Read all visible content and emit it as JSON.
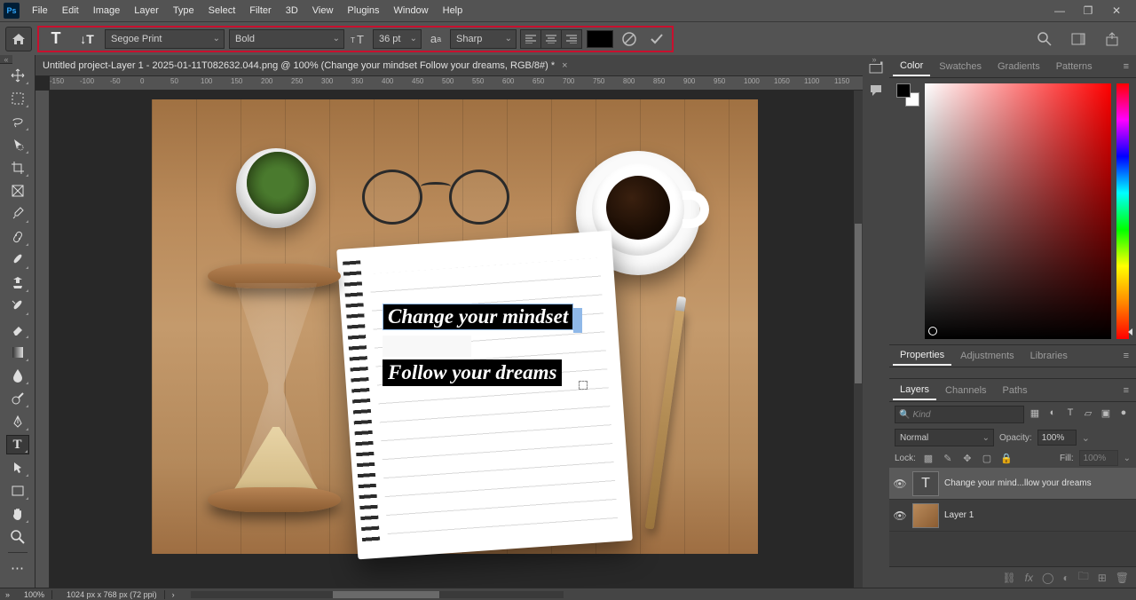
{
  "menu": {
    "items": [
      "File",
      "Edit",
      "Image",
      "Layer",
      "Type",
      "Select",
      "Filter",
      "3D",
      "View",
      "Plugins",
      "Window",
      "Help"
    ]
  },
  "options": {
    "font_family": "Segoe Print",
    "font_style": "Bold",
    "font_size": "36 pt",
    "aa": "Sharp",
    "text_color": "#000000"
  },
  "document": {
    "tab_title": "Untitled project-Layer 1 - 2025-01-11T082632.044.png @ 100% (Change your mindset  Follow your dreams, RGB/8#) *",
    "ruler_ticks": [
      "-150",
      "-100",
      "-50",
      "0",
      "50",
      "100",
      "150",
      "200",
      "250",
      "300",
      "350",
      "400",
      "450",
      "500",
      "550",
      "600",
      "650",
      "700",
      "750",
      "800",
      "850",
      "900",
      "950",
      "1000",
      "1050",
      "1100",
      "1150"
    ]
  },
  "canvas_text": {
    "line1": "Change your mindset",
    "line2": "Follow your dreams"
  },
  "color_tabs": [
    "Color",
    "Swatches",
    "Gradients",
    "Patterns"
  ],
  "mid_tabs": [
    "Properties",
    "Adjustments",
    "Libraries"
  ],
  "layer_tabs": [
    "Layers",
    "Channels",
    "Paths"
  ],
  "layers": {
    "search_placeholder": "Kind",
    "blend_mode": "Normal",
    "opacity_label": "Opacity:",
    "opacity_value": "100%",
    "lock_label": "Lock:",
    "fill_label": "Fill:",
    "fill_value": "100%",
    "items": [
      {
        "name": "Change your mind...llow your dreams",
        "type": "text"
      },
      {
        "name": "Layer 1",
        "type": "image"
      }
    ]
  },
  "status": {
    "zoom": "100%",
    "dims": "1024 px x 768 px (72 ppi)"
  }
}
